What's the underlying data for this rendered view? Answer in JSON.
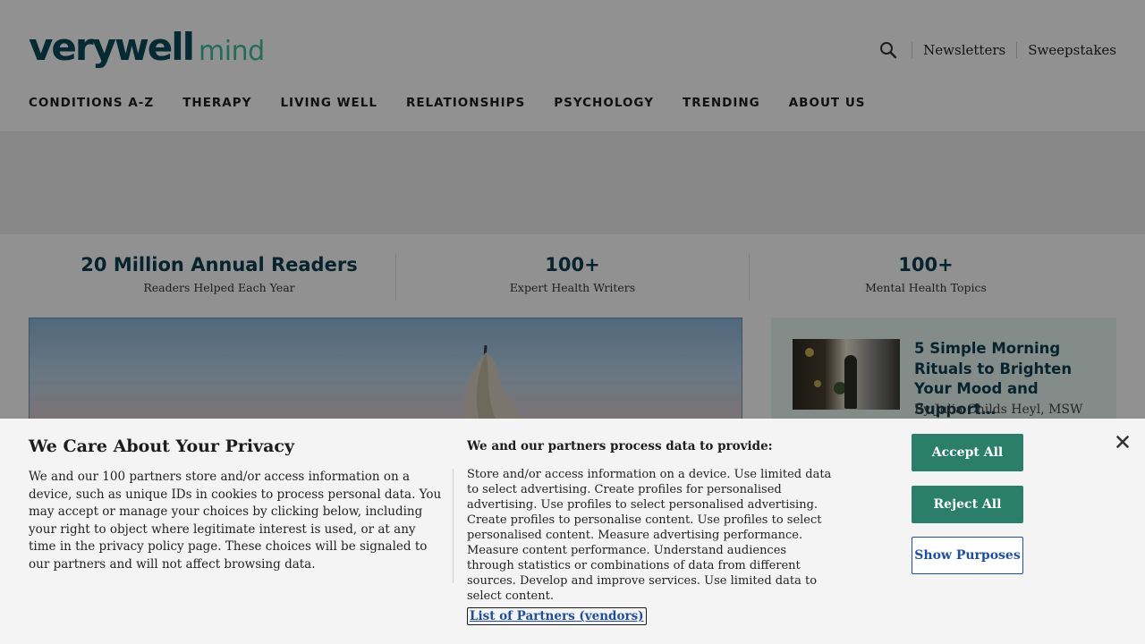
{
  "brand": {
    "logo_primary": "verywell",
    "logo_secondary": "mind",
    "primary_color": "#0c4a5c",
    "secondary_color": "#3fbf9a"
  },
  "header": {
    "search_icon": "search-icon",
    "links": [
      "Newsletters",
      "Sweepstakes"
    ]
  },
  "nav": {
    "items": [
      "CONDITIONS A-Z",
      "THERAPY",
      "LIVING WELL",
      "RELATIONSHIPS",
      "PSYCHOLOGY",
      "TRENDING",
      "ABOUT US"
    ]
  },
  "stats": [
    {
      "title": "20 Million Annual Readers",
      "subtitle": "Readers Helped Each Year"
    },
    {
      "title": "100+",
      "subtitle": "Expert Health Writers"
    },
    {
      "title": "100+",
      "subtitle": "Mental Health Topics"
    }
  ],
  "featured_card": {
    "title": "5 Simple Morning Rituals to Brighten Your Mood and Support…",
    "byline": "By Julia Childs Heyl, MSW"
  },
  "consent": {
    "title": "We Care About Your Privacy",
    "body": "We and our 100 partners store and/or access information on a device, such as unique IDs in cookies to process personal data. You may accept or manage your choices by clicking below, including your right to object where legitimate interest is used, or at any time in the privacy policy page. These choices will be signaled to our partners and will not affect browsing data.",
    "purposes_title": "We and our partners process data to provide:",
    "purposes_body": "Store and/or access information on a device. Use limited data to select advertising. Create profiles for personalised advertising. Use profiles to select personalised advertising. Create profiles to personalise content. Use profiles to select personalised content. Measure advertising performance. Measure content performance. Understand audiences through statistics or combinations of data from different sources. Develop and improve services. Use limited data to select content.",
    "partners_link": "List of Partners (vendors)",
    "accept_label": "Accept All",
    "reject_label": "Reject All",
    "purposes_label": "Show Purposes",
    "close_icon": "close-icon",
    "button_color": "#2b7f6a",
    "link_color": "#1f4f9c"
  }
}
